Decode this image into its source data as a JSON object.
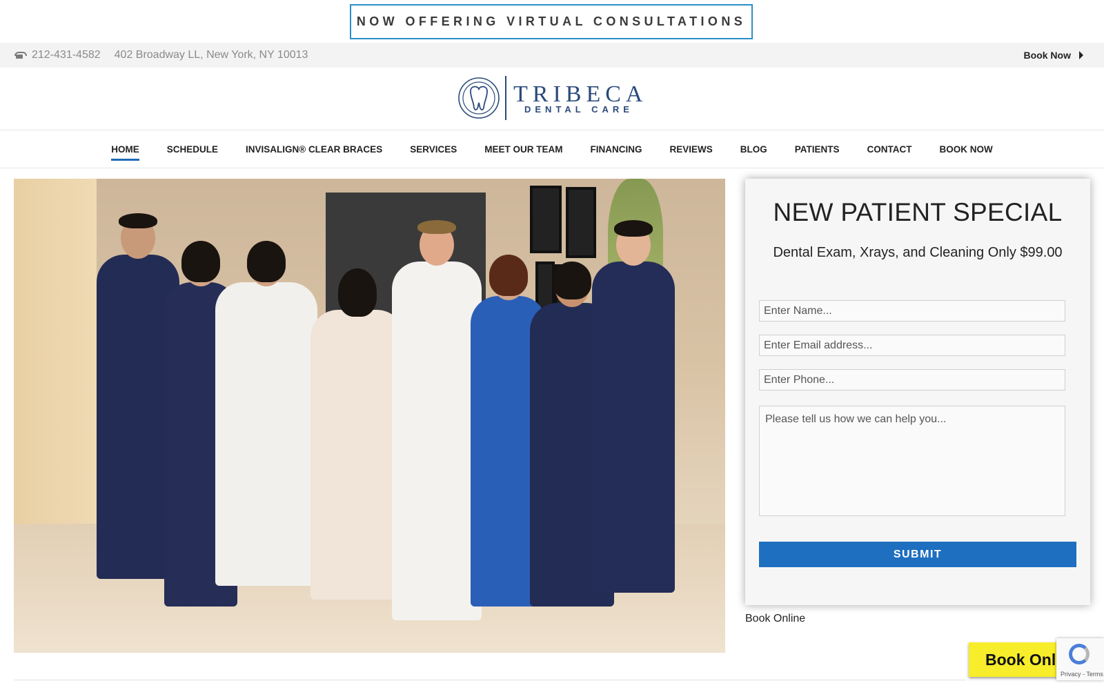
{
  "announcement": {
    "text": "NOW OFFERING VIRTUAL CONSULTATIONS"
  },
  "infobar": {
    "phone_icon": "phone-icon",
    "phone": "212-431-4582",
    "address": "402 Broadway LL, New York, NY 10013",
    "book_now": "Book Now"
  },
  "logo": {
    "title": "TRIBECA",
    "subtitle": "DENTAL CARE",
    "icon": "tooth-logo-icon"
  },
  "nav": {
    "items": [
      {
        "label": "HOME",
        "active": true
      },
      {
        "label": "SCHEDULE"
      },
      {
        "label": "INVISALIGN® CLEAR BRACES"
      },
      {
        "label": "SERVICES"
      },
      {
        "label": "MEET OUR TEAM"
      },
      {
        "label": "FINANCING"
      },
      {
        "label": "REVIEWS"
      },
      {
        "label": "BLOG"
      },
      {
        "label": "PATIENTS"
      },
      {
        "label": "CONTACT"
      },
      {
        "label": "BOOK NOW"
      }
    ]
  },
  "form": {
    "heading": "NEW PATIENT SPECIAL",
    "subheading": "Dental Exam, Xrays, and Cleaning Only $99.00",
    "name_placeholder": "Enter Name...",
    "email_placeholder": "Enter Email address...",
    "phone_placeholder": "Enter Phone...",
    "message_placeholder": "Please tell us how we can help you...",
    "submit": "SUBMIT"
  },
  "book_online": {
    "link": "Book Online",
    "button": "Book Online"
  },
  "recaptcha": {
    "legal": "Privacy - Terms"
  },
  "colors": {
    "accent": "#1e6fc0",
    "nav_active": "#1e6bb3",
    "brand": "#2a4a7a",
    "announce_border": "#2a8fc9",
    "book_button": "#f7ed2a"
  }
}
